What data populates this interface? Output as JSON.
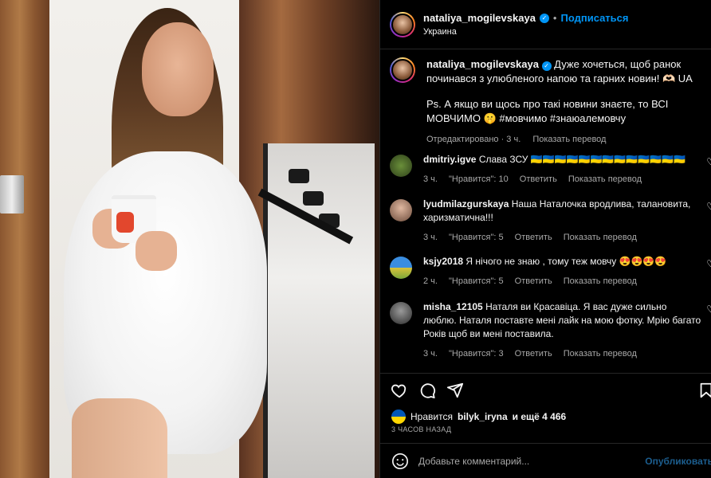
{
  "post": {
    "username": "nataliya_mogilevskaya",
    "follow_label": "Подписаться",
    "location": "Украина",
    "caption": {
      "text_line1": "Дуже хочеться, щоб ранок починався з улюбленого напою та гарних новин! 🫶🏻 UA",
      "text_line2": "Ps. А якщо ви щось про такі новини знаєте, то ВСІ МОВЧИМО 🤫 #мовчимо #знаюалемовчу",
      "edited": "Отредактировано · 3 ч.",
      "translate": "Показать перевод"
    }
  },
  "comments": [
    {
      "username": "dmitriy.igve",
      "text": "Слава ЗСУ 🇺🇦🇺🇦🇺🇦🇺🇦🇺🇦🇺🇦🇺🇦🇺🇦🇺🇦🇺🇦🇺🇦🇺🇦🇺🇦",
      "time": "3 ч.",
      "likes": "\"Нравится\": 10",
      "reply": "Ответить",
      "translate": "Показать перевод"
    },
    {
      "username": "lyudmilazgurskaya",
      "text": "Наша Наталочка вродлива, талановита, харизматична!!!",
      "time": "3 ч.",
      "likes": "\"Нравится\": 5",
      "reply": "Ответить",
      "translate": "Показать перевод"
    },
    {
      "username": "ksjy2018",
      "text": "Я нічого не знаю , тому теж мовчу 😍😍😍😍",
      "time": "2 ч.",
      "likes": "\"Нравится\": 5",
      "reply": "Ответить",
      "translate": "Показать перевод"
    },
    {
      "username": "misha_12105",
      "text": "Наталя ви Красавіца. Я вас дуже сильно люблю. Наталя поставте мені лайк на мою фотку. Мрію багато Років щоб ви мені поставила.",
      "time": "3 ч.",
      "likes": "\"Нравится\": 3",
      "reply": "Ответить",
      "translate": "Показать перевод"
    }
  ],
  "likes_summary": {
    "prefix": "Нравится",
    "user": "bilyk_iryna",
    "suffix": "и ещё 4 466"
  },
  "posted_ago": "3 ЧАСОВ НАЗАД",
  "add_comment": {
    "placeholder": "Добавьте комментарий...",
    "publish_label": "Опубликовать"
  },
  "colors": {
    "accent_blue": "#0095f6",
    "publish_disabled": "#1c5e8f",
    "muted_text": "#a8a8a8",
    "divider": "#262626"
  },
  "icons": [
    "verified-badge-icon",
    "heart-icon",
    "comment-icon",
    "share-icon",
    "bookmark-icon",
    "emoji-icon",
    "ukraine-flag-icon"
  ]
}
